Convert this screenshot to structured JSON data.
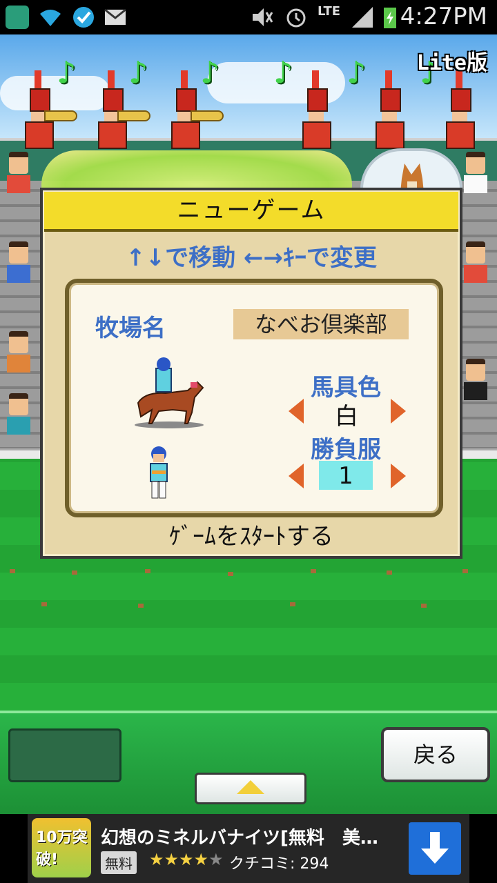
{
  "status_bar": {
    "time": "4:27PM",
    "network": "LTE",
    "icons": [
      "t-shield-icon",
      "wifi-icon",
      "check-icon",
      "mail-icon",
      "mute-icon",
      "alarm-icon",
      "signal-icon",
      "battery-charging-icon"
    ]
  },
  "game": {
    "edition_badge": "Lite版",
    "dialog": {
      "title": "ニューゲーム",
      "help": "↑↓で移動 ←→ｷｰで変更",
      "farm_name_label": "牧場名",
      "farm_name_value": "なべお倶楽部",
      "tack_color_label": "馬具色",
      "tack_color_value": "白",
      "silks_label": "勝負服",
      "silks_value": "1",
      "start_label": "ｹﾞｰﾑをｽﾀｰﾄする"
    },
    "controls": {
      "back_label": "戻る"
    }
  },
  "ad": {
    "title": "幻想のミネルバナイツ[無料　美女...",
    "free_badge": "無料",
    "rating": 4,
    "reviews_label": "クチコミ: 294",
    "icon_text": "10万突破!"
  },
  "colors": {
    "dialog_title_bg": "#f3dc2a",
    "label_blue": "#3d6fc6",
    "arrow_orange": "#e0642a",
    "silks_box": "#7fe9ea",
    "controls_green": "#2bb64a"
  }
}
